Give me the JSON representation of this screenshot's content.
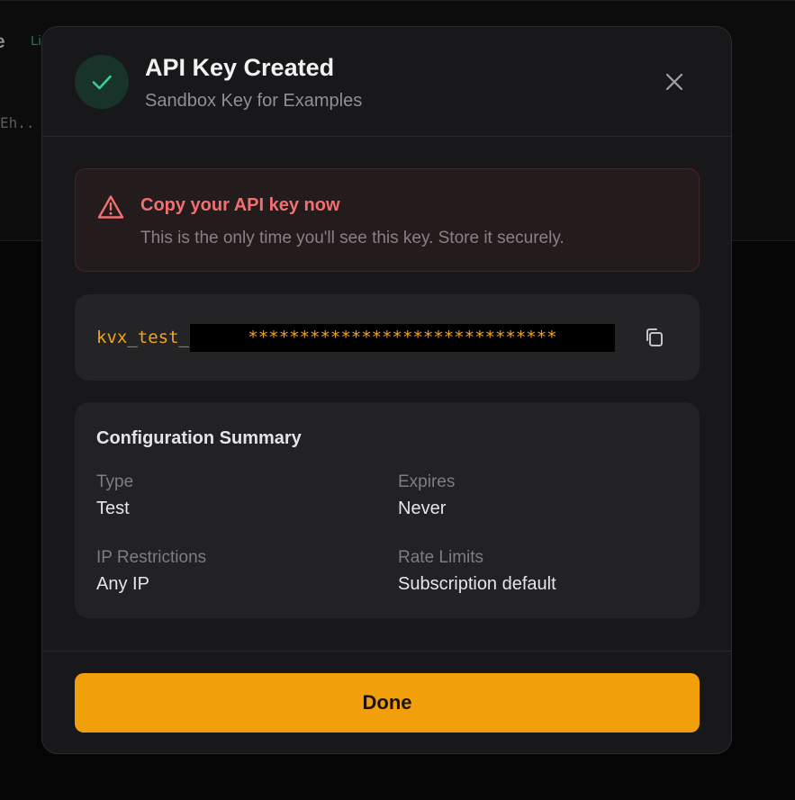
{
  "background": {
    "title_fragment": "e",
    "badge_fragment": "Li",
    "text_fragment": "Eh.."
  },
  "modal": {
    "title": "API Key Created",
    "subtitle": "Sandbox Key for Examples",
    "icons": {
      "status": "check-icon",
      "close": "close-icon",
      "warning": "warning-triangle-icon",
      "copy": "copy-icon"
    },
    "warning": {
      "title": "Copy your API key now",
      "text": "This is the only time you'll see this key. Store it securely."
    },
    "key": {
      "prefix": "kvx_test_",
      "masked": "******************************"
    },
    "summary": {
      "title": "Configuration Summary",
      "fields": [
        {
          "label": "Type",
          "value": "Test"
        },
        {
          "label": "Expires",
          "value": "Never"
        },
        {
          "label": "IP Restrictions",
          "value": "Any IP"
        },
        {
          "label": "Rate Limits",
          "value": "Subscription default"
        }
      ]
    },
    "done_label": "Done"
  },
  "colors": {
    "accent": "#f29f0c",
    "success": "#3ecf8e",
    "danger": "#f26f72",
    "modal_bg": "#18181a"
  }
}
